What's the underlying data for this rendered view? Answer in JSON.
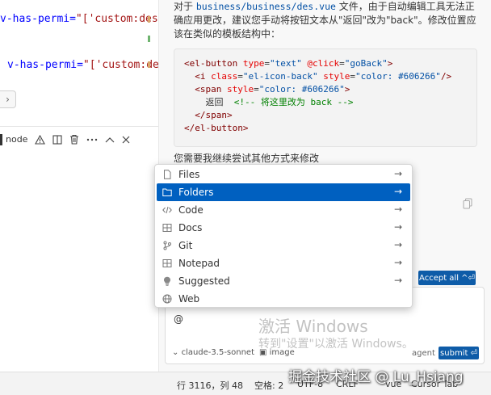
{
  "editor": {
    "lines": [
      {
        "prefix": "v-has-permi=",
        "value": "\"['custom:des"
      },
      {
        "prefix": "v-has-permi=",
        "value": "\"['custom:des"
      }
    ],
    "expander": "›"
  },
  "terminal_toolbar": {
    "node_label": "node"
  },
  "chat": {
    "message_prefix": "对于 ",
    "message_path": "business/business/des.vue",
    "message_rest": " 文件，由于自动编辑工具无法正确应用更改，建议您手动将按钮文本从\"返回\"改为\"back\"。修改位置应该在类似的模板结构中：",
    "code_lines": [
      "<el-button type=\"text\" @click=\"goBack\">",
      "  <i class=\"el-icon-back\" style=\"color: #606266\"/>",
      "  <span style=\"color: #606266\">",
      "    返回  <!-- 将这里改为 back -->",
      "  </span>",
      "</el-button>"
    ],
    "followup": "您需要我继续尝试其他方式来修改",
    "accept_all": "Accept all ^⏎",
    "input_value": "@",
    "model": "claude-3.5-sonnet",
    "image_label": "image",
    "agent_label": "agent",
    "submit_label": "submit ⏎"
  },
  "context_menu": {
    "items": [
      {
        "label": "Files",
        "icon": "file-icon",
        "active": false
      },
      {
        "label": "Folders",
        "icon": "folder-icon",
        "active": true
      },
      {
        "label": "Code",
        "icon": "code-icon",
        "active": false
      },
      {
        "label": "Docs",
        "icon": "docs-icon",
        "active": false
      },
      {
        "label": "Git",
        "icon": "git-icon",
        "active": false
      },
      {
        "label": "Notepad",
        "icon": "notepad-icon",
        "active": false
      },
      {
        "label": "Suggested",
        "icon": "lightbulb-icon",
        "active": false
      },
      {
        "label": "Web",
        "icon": "globe-icon",
        "active": false
      }
    ],
    "arrow": "→"
  },
  "watermark": {
    "line1": "激活 Windows",
    "line2": "转到\"设置\"以激活 Windows。"
  },
  "status_bar": {
    "position": "行 3116，列 48",
    "spaces": "空格: 2",
    "encoding": "UTF-8",
    "eol": "CRLF",
    "language": "vue",
    "cursor_tab": "Cursor Tab"
  },
  "overlay_watermark": "掘金技术社区 @ Lu_Hsiang",
  "colors": {
    "accent": "#0060c0",
    "button": "#0e5ca8"
  }
}
